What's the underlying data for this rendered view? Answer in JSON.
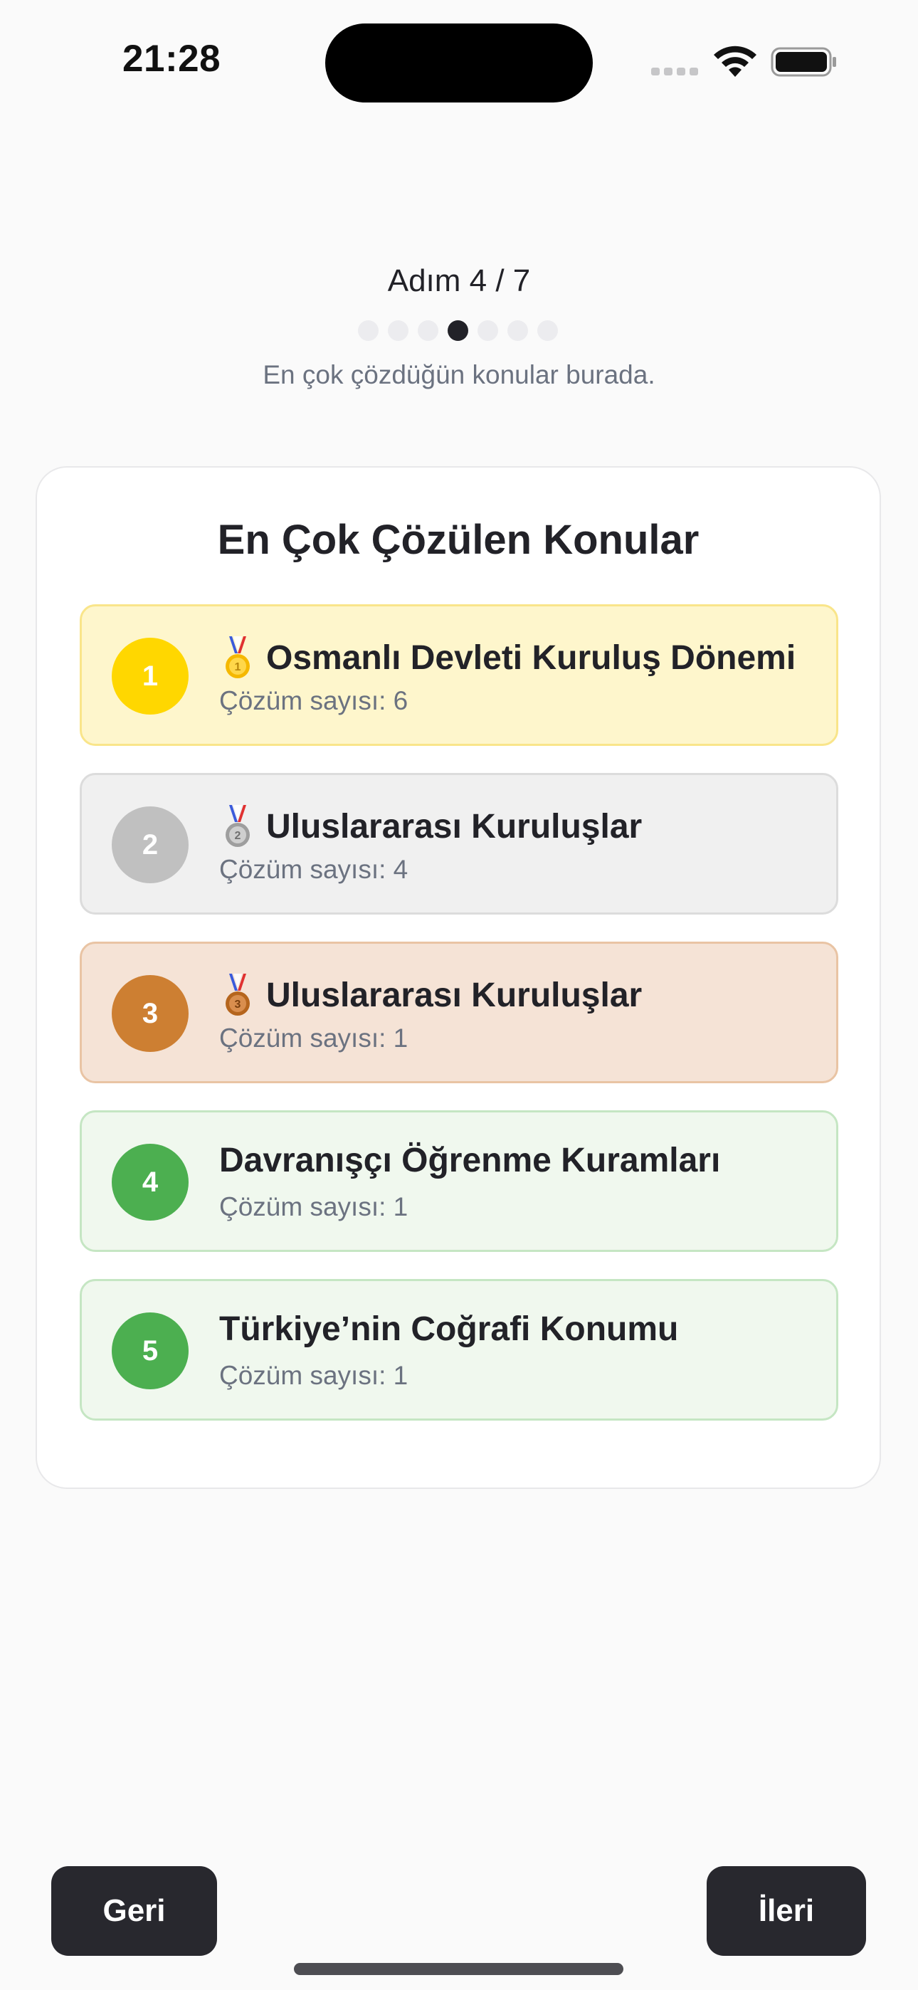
{
  "status_bar": {
    "time": "21:28"
  },
  "header": {
    "step": "Adım 4 / 7",
    "subtitle": "En çok çözdüğün konular burada.",
    "total_steps": 7,
    "current_step": 4
  },
  "card": {
    "title": "En Çok Çözülen Konular",
    "items": [
      {
        "rank": "1",
        "medal": "gold-medal-icon",
        "topic": "Osmanlı Devleti Kuruluş Dönemi",
        "count": "Çözüm sayısı: 6"
      },
      {
        "rank": "2",
        "medal": "silver-medal-icon",
        "topic": "Uluslararası Kuruluşlar",
        "count": "Çözüm sayısı: 4"
      },
      {
        "rank": "3",
        "medal": "bronze-medal-icon",
        "topic": "Uluslararası Kuruluşlar",
        "count": "Çözüm sayısı: 1"
      },
      {
        "rank": "4",
        "medal": "",
        "topic": "Davranışçı Öğrenme Kuramları",
        "count": "Çözüm sayısı: 1"
      },
      {
        "rank": "5",
        "medal": "",
        "topic": "Türkiye’nin Coğrafi Konumu",
        "count": "Çözüm sayısı: 1"
      }
    ]
  },
  "footer": {
    "back_label": "Geri",
    "next_label": "İleri"
  },
  "colors": {
    "gold": "#FFD700",
    "gold_bg": "#FEF6CC",
    "gold_border": "#F9E58A",
    "silver": "#C0C0C0",
    "silver_bg": "#F0F0F0",
    "silver_border": "#DCDCDC",
    "bronze": "#CD7F32",
    "bronze_bg": "#F5E3D6",
    "bronze_border": "#E9C4A4",
    "green": "#4CAF50",
    "green_bg": "#F0F8EE",
    "green_border": "#C5E6C3",
    "button": "#28282E"
  }
}
